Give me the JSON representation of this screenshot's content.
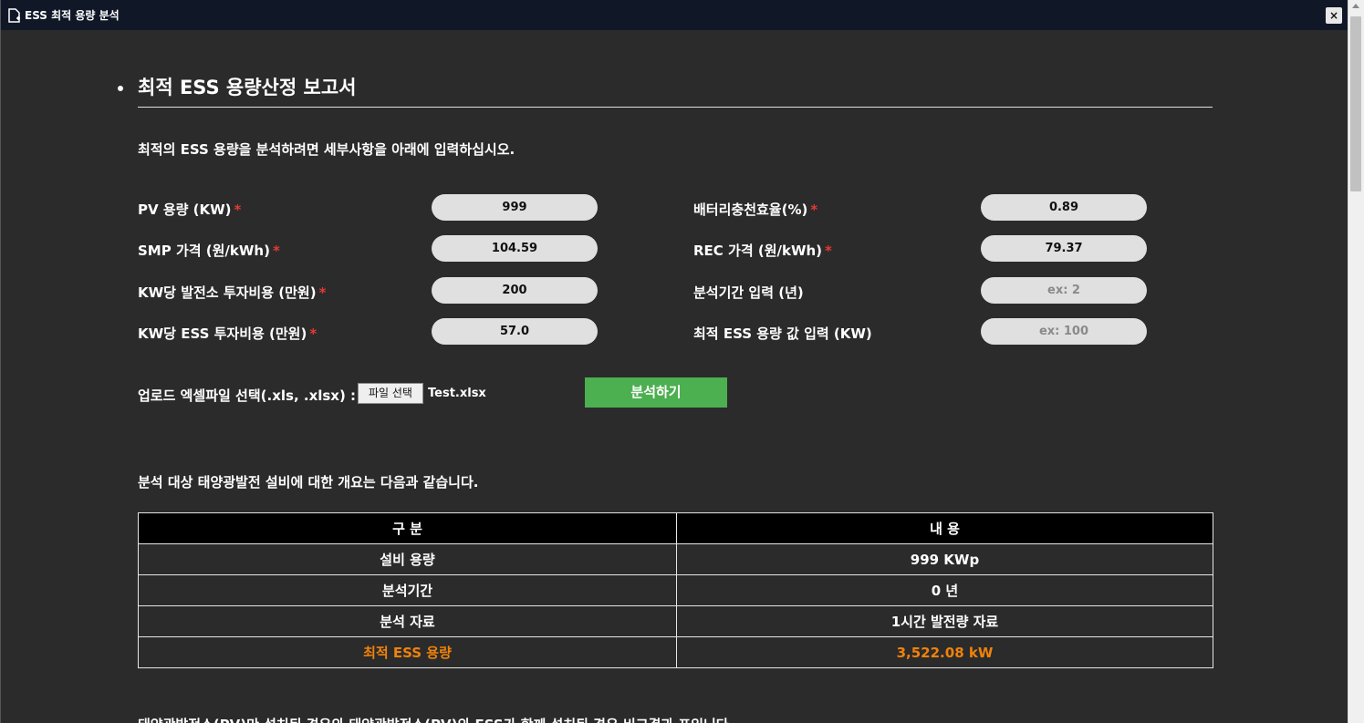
{
  "window": {
    "title": "ESS 최적 용량 분석",
    "close_label": "×"
  },
  "report": {
    "title": "최적 ESS 용량산정 보고서",
    "intro": "최적의 ESS 용량을 분석하려면 세부사항을 아래에 입력하십시오."
  },
  "form": {
    "required_mark": "*",
    "pv_capacity": {
      "label": "PV 용량 (KW)",
      "value": "999"
    },
    "smp_price": {
      "label": "SMP 가격 (원/kWh)",
      "value": "104.59"
    },
    "plant_cost": {
      "label": "KW당 발전소 투자비용 (만원)",
      "value": "200"
    },
    "ess_cost": {
      "label": "KW당 ESS 투자비용 (만원)",
      "value": "57.0"
    },
    "battery_eff": {
      "label": "배터리충천효율(%)",
      "value": "0.89"
    },
    "rec_price": {
      "label": "REC 가격 (원/kWh)",
      "value": "79.37"
    },
    "period": {
      "label": "분석기간 입력 (년)",
      "placeholder": "ex: 2"
    },
    "ess_value": {
      "label": "최적 ESS 용량 값 입력 (KW)",
      "placeholder": "ex: 100"
    },
    "upload_label": "업로드 엑셀파일 선택(.xls, .xlsx) :",
    "file_button": "파일 선택",
    "file_name": "Test.xlsx",
    "analyze_button": "분석하기"
  },
  "summary": {
    "heading": "분석 대상 태양광발전 설비에 대한 개요는 다음과 같습니다.",
    "columns": [
      "구 분",
      "내 용"
    ],
    "rows": [
      [
        "설비 용량",
        "999 KWp"
      ],
      [
        "분석기간",
        "0 년"
      ],
      [
        "분석 자료",
        "1시간 발전량 자료"
      ],
      [
        "최적 ESS 용량",
        "3,522.08 kW"
      ]
    ],
    "highlight_color": "#f0820a"
  },
  "footer_text": "태양광발전소(PV)만 설치된 경우와 태양광발전소(PV)와 ESS가 함께 설치된 경우 비교결과 표입니다."
}
